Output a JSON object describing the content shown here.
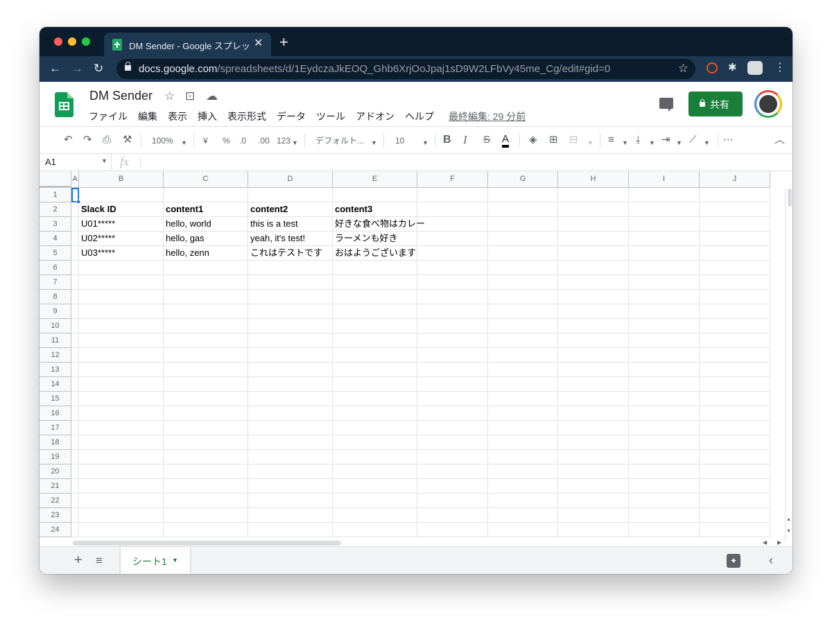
{
  "browser": {
    "tab_title": "DM Sender - Google スプレッドシート",
    "tab_close": "✕",
    "new_tab": "+",
    "url_host": "docs.google.com",
    "url_path": "/spreadsheets/d/1EydczaJkEOQ_Ghb6XrjOoJpaj1sD9W2LFbVy45me_Cg/edit#gid=0"
  },
  "header": {
    "doc_title": "DM Sender",
    "menu": [
      "ファイル",
      "編集",
      "表示",
      "挿入",
      "表示形式",
      "データ",
      "ツール",
      "アドオン",
      "ヘルプ"
    ],
    "last_edit": "最終編集: 29 分前",
    "share_label": "共有"
  },
  "toolbar": {
    "zoom": "100%",
    "currency": "¥",
    "percent": "%",
    "decimal_decrease": ".0",
    "decimal_increase": ".00",
    "format_more": "123",
    "font": "デフォルト...",
    "font_size": "10",
    "bold": "B",
    "italic": "I",
    "strike": "S",
    "text_color": "A"
  },
  "formula_bar": {
    "name_box": "A1",
    "fx": "fx",
    "value": ""
  },
  "grid": {
    "columns": [
      "A",
      "B",
      "C",
      "D",
      "E",
      "F",
      "G",
      "H",
      "I",
      "J"
    ],
    "rows": [
      "1",
      "2",
      "3",
      "4",
      "5",
      "6",
      "7",
      "8",
      "9",
      "10",
      "11",
      "12",
      "13",
      "14",
      "15",
      "16",
      "17",
      "18",
      "19",
      "20",
      "21",
      "22",
      "23",
      "24"
    ],
    "data": {
      "header": [
        "Slack ID",
        "content1",
        "content2",
        "content3"
      ],
      "row3": [
        "U01*****",
        "hello, world",
        "this is a test",
        "好きな食べ物はカレー"
      ],
      "row4": [
        "U02*****",
        "hello, gas",
        "yeah, it's test!",
        "ラーメンも好き"
      ],
      "row5": [
        "U03*****",
        "hello, zenn",
        "これはテストです",
        "おはようございます"
      ]
    }
  },
  "sheetbar": {
    "add": "+",
    "all_sheets": "≡",
    "sheet_name": "シート1",
    "explore": "✦",
    "collapse": "‹"
  },
  "colors": {
    "chrome_dark": "#0b1c2c",
    "chrome_tab": "#1e3852",
    "share_green": "#188038",
    "selection_blue": "#1a73e8"
  }
}
